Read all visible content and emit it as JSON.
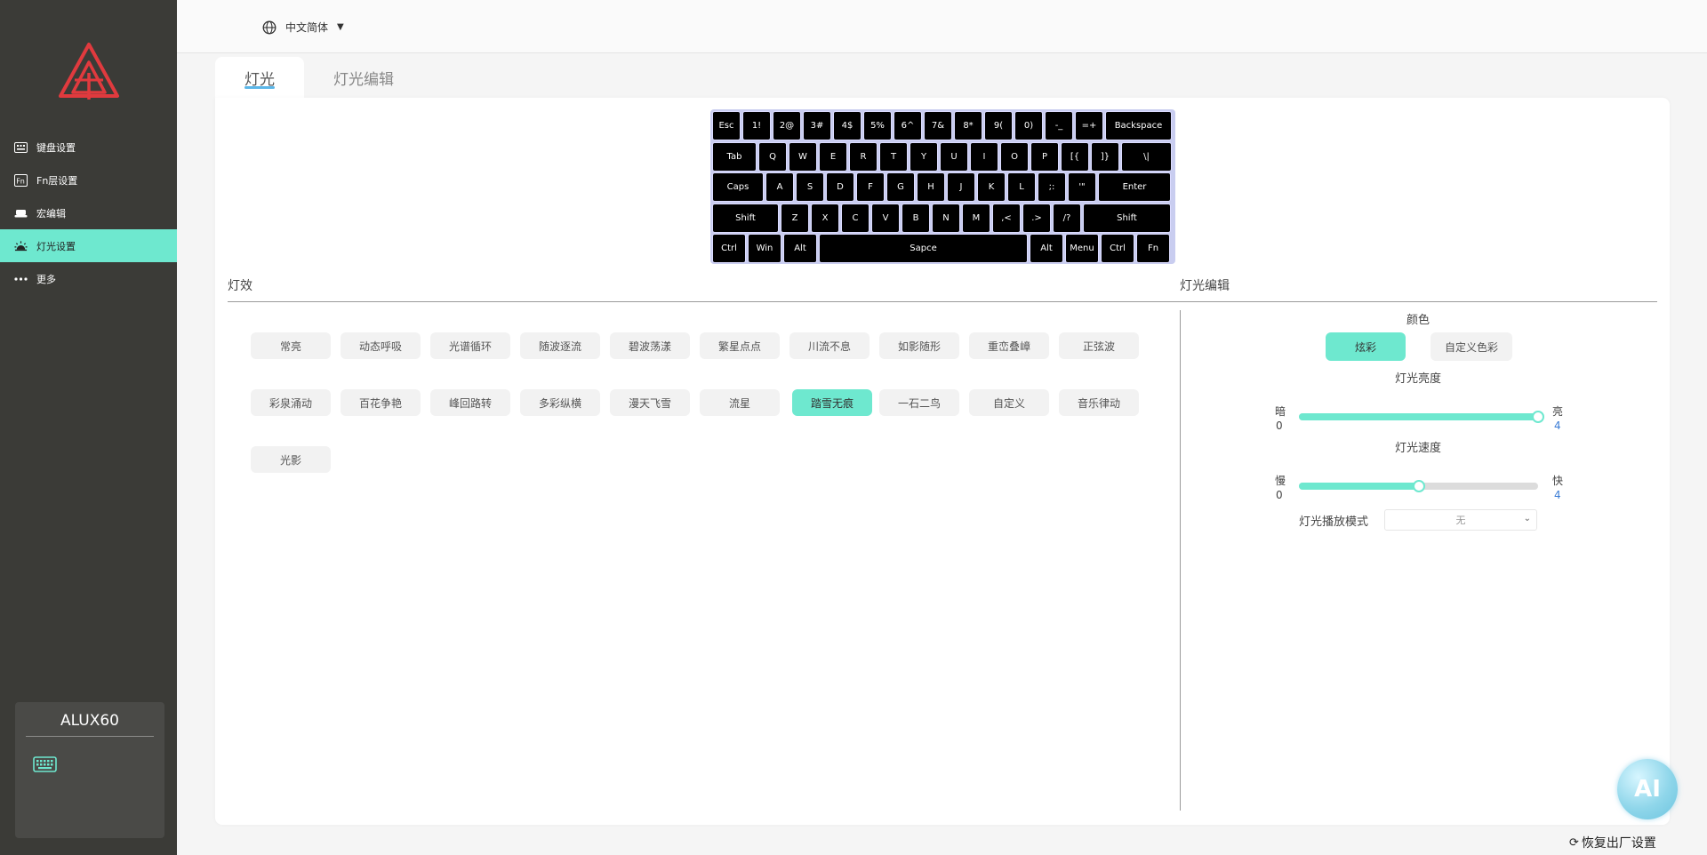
{
  "language": {
    "label": "中文简体"
  },
  "sidebar": {
    "items": [
      {
        "label": "键盘设置",
        "icon": "keyboard-grid-icon"
      },
      {
        "label": "Fn层设置",
        "icon": "fn-layer-icon"
      },
      {
        "label": "宏编辑",
        "icon": "macro-icon"
      },
      {
        "label": "灯光设置",
        "icon": "light-icon"
      },
      {
        "label": "更多",
        "icon": "more-dots-icon"
      }
    ],
    "device_name": "ALUX60"
  },
  "tabs": [
    {
      "label": "灯光"
    },
    {
      "label": "灯光编辑"
    }
  ],
  "keyboard": {
    "rows": [
      [
        "Esc",
        "1!",
        "2@",
        "3#",
        "4$",
        "5%",
        "6^",
        "7&",
        "8*",
        "9(",
        "0)",
        "-_",
        "=+",
        "Backspace"
      ],
      [
        "Tab",
        "Q",
        "W",
        "E",
        "R",
        "T",
        "Y",
        "U",
        "I",
        "O",
        "P",
        "[{",
        "]}",
        "\\|"
      ],
      [
        "Caps",
        "A",
        "S",
        "D",
        "F",
        "G",
        "H",
        "J",
        "K",
        "L",
        ";:",
        "'\"",
        "Enter"
      ],
      [
        "Shift",
        "Z",
        "X",
        "C",
        "V",
        "B",
        "N",
        "M",
        ",<",
        ".>",
        "/?",
        "Shift"
      ],
      [
        "Ctrl",
        "Win",
        "Alt",
        "Sapce",
        "Alt",
        "Menu",
        "Ctrl",
        "Fn"
      ]
    ]
  },
  "effects": {
    "title": "灯效",
    "items": [
      "常亮",
      "动态呼吸",
      "光谱循环",
      "随波逐流",
      "碧波荡漾",
      "繁星点点",
      "川流不息",
      "如影随形",
      "重峦叠嶂",
      "正弦波",
      "彩泉涌动",
      "百花争艳",
      "峰回路转",
      "多彩纵横",
      "漫天飞雪",
      "流星",
      "踏雪无痕",
      "一石二鸟",
      "自定义",
      "音乐律动",
      "光影"
    ],
    "selected": "踏雪无痕"
  },
  "editor": {
    "title": "灯光编辑",
    "color_label": "颜色",
    "color_options": [
      "炫彩",
      "自定义色彩"
    ],
    "color_selected": "炫彩",
    "brightness": {
      "label": "灯光亮度",
      "min_label": "暗",
      "max_label": "亮",
      "min": "0",
      "max": "4",
      "value": 4
    },
    "speed": {
      "label": "灯光速度",
      "min_label": "慢",
      "max_label": "快",
      "min": "0",
      "max": "4",
      "value": 2
    },
    "play_mode": {
      "label": "灯光播放模式",
      "value": "无"
    }
  },
  "ai_button": {
    "label": "AI"
  },
  "reset": {
    "label": "恢复出厂设置"
  },
  "colors": {
    "accent": "#6ee8cf",
    "sidebar": "#3b3b37",
    "brand_red": "#e03a3e"
  }
}
